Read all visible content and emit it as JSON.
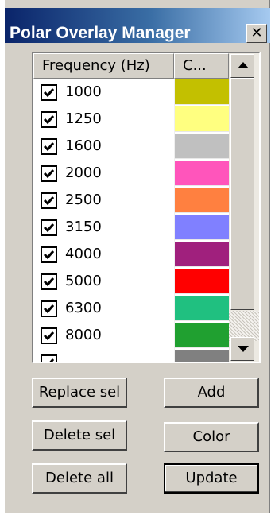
{
  "window": {
    "title": "Polar Overlay Manager",
    "close_glyph": "✕"
  },
  "list": {
    "columns": {
      "frequency": "Frequency (Hz)",
      "color": "C..."
    },
    "rows": [
      {
        "freq": "1000",
        "checked": true,
        "color": "#c3c000"
      },
      {
        "freq": "1250",
        "checked": true,
        "color": "#ffff80"
      },
      {
        "freq": "1600",
        "checked": true,
        "color": "#c0c0c0"
      },
      {
        "freq": "2000",
        "checked": true,
        "color": "#ff55bb"
      },
      {
        "freq": "2500",
        "checked": true,
        "color": "#ff8040"
      },
      {
        "freq": "3150",
        "checked": true,
        "color": "#8080ff"
      },
      {
        "freq": "4000",
        "checked": true,
        "color": "#a0207d"
      },
      {
        "freq": "5000",
        "checked": true,
        "color": "#ff0000"
      },
      {
        "freq": "6300",
        "checked": true,
        "color": "#20c080"
      },
      {
        "freq": "8000",
        "checked": true,
        "color": "#20a030"
      },
      {
        "freq": "",
        "checked": true,
        "color": "#808080"
      }
    ]
  },
  "buttons": {
    "replace_sel": "Replace sel",
    "add": "Add",
    "delete_sel": "Delete sel",
    "color": "Color",
    "delete_all": "Delete all",
    "update": "Update"
  }
}
